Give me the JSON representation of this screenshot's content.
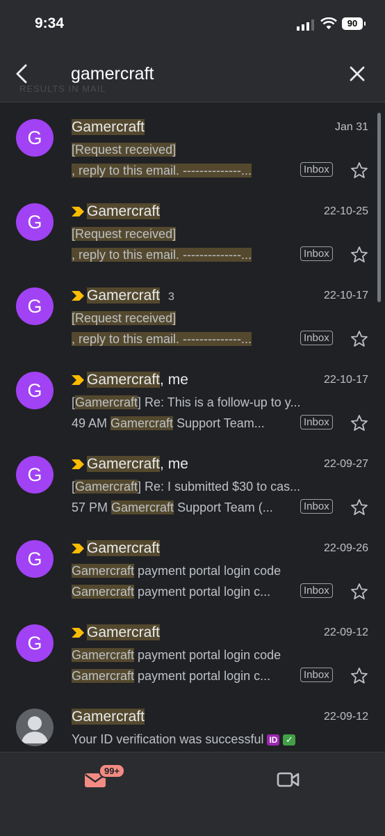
{
  "status": {
    "time": "9:34",
    "battery": "90"
  },
  "search": {
    "query": "gamercraft",
    "ghost_label": "Results in mail"
  },
  "emails": [
    {
      "avatar": "G",
      "sender_hl": "Gamercraft",
      "sender_rest": "",
      "count": "",
      "important": false,
      "date": "Jan 31",
      "line1": [
        "",
        "[Request received]",
        ""
      ],
      "line2": [
        "",
        ", reply to this email. --------------...",
        ""
      ],
      "label": "Inbox"
    },
    {
      "avatar": "G",
      "sender_hl": "Gamercraft",
      "sender_rest": "",
      "count": "",
      "important": true,
      "date": "22-10-25",
      "line1": [
        "",
        "[Request received]",
        ""
      ],
      "line2": [
        "",
        ", reply to this email. --------------...",
        ""
      ],
      "label": "Inbox"
    },
    {
      "avatar": "G",
      "sender_hl": "Gamercraft",
      "sender_rest": "",
      "count": "3",
      "important": true,
      "date": "22-10-17",
      "line1": [
        "",
        "[Request received]",
        ""
      ],
      "line2": [
        "",
        ", reply to this email. --------------...",
        ""
      ],
      "label": "Inbox"
    },
    {
      "avatar": "G",
      "sender_hl": "Gamercraft",
      "sender_rest": ", me",
      "count": "",
      "important": true,
      "date": "22-10-17",
      "line1": [
        "[",
        "Gamercraft",
        "] Re: This is a follow-up to y..."
      ],
      "line2": [
        "49 AM ",
        "Gamercraft",
        " Support Team..."
      ],
      "label": "Inbox"
    },
    {
      "avatar": "G",
      "sender_hl": "Gamercraft",
      "sender_rest": ", me",
      "count": "",
      "important": true,
      "date": "22-09-27",
      "line1": [
        "[",
        "Gamercraft",
        "] Re: I submitted $30 to cas..."
      ],
      "line2": [
        "57 PM ",
        "Gamercraft",
        " Support Team (..."
      ],
      "label": "Inbox"
    },
    {
      "avatar": "G",
      "sender_hl": "Gamercraft",
      "sender_rest": "",
      "count": "",
      "important": true,
      "date": "22-09-26",
      "line1": [
        "",
        "Gamercraft",
        " payment portal login code"
      ],
      "line2": [
        "",
        "Gamercraft",
        " payment portal login c..."
      ],
      "label": "Inbox"
    },
    {
      "avatar": "G",
      "sender_hl": "Gamercraft",
      "sender_rest": "",
      "count": "",
      "important": true,
      "date": "22-09-12",
      "line1": [
        "",
        "Gamercraft",
        " payment portal login code"
      ],
      "line2": [
        "",
        "Gamercraft",
        " payment portal login c..."
      ],
      "label": "Inbox"
    },
    {
      "avatar": "person",
      "sender_hl": "Gamercraft",
      "sender_rest": "",
      "count": "",
      "important": false,
      "date": "22-09-12",
      "line1": [
        "",
        "",
        "Your ID verification was successful "
      ],
      "line2": [
        "",
        "",
        ""
      ],
      "label": "",
      "emoji1": "ID",
      "emoji2": "✓"
    }
  ],
  "bottom": {
    "mail_badge": "99+"
  }
}
